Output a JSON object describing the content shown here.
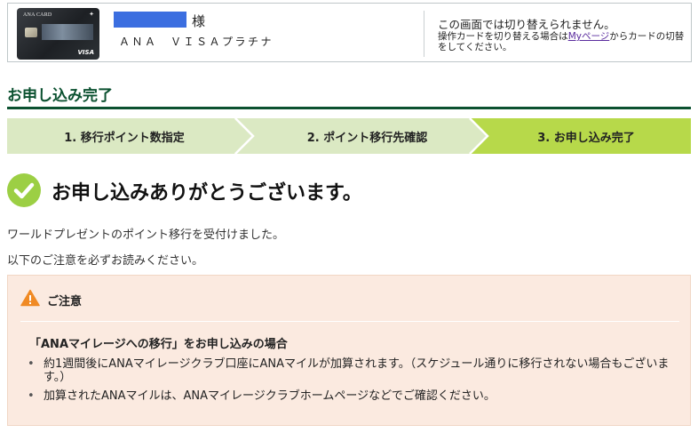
{
  "card": {
    "brand_text": "ANA CARD",
    "network_text": "VISA",
    "name_suffix": "様",
    "card_name": "ＡＮＡ　ＶＩＳＡプラチナ"
  },
  "notice": {
    "main": "この画面では切り替えられません。",
    "sub_before": "操作カードを切り替える場合は",
    "sub_link": "Myページ",
    "sub_after": "からカードの切替をしてください。"
  },
  "page": {
    "title": "お申し込み完了"
  },
  "steps": [
    {
      "label": "1. 移行ポイント数指定"
    },
    {
      "label": "2. ポイント移行先確認"
    },
    {
      "label": "3. お申し込み完了"
    }
  ],
  "completion": {
    "heading": "お申し込みありがとうございます。",
    "message1": "ワールドプレゼントのポイント移行を受付けました。",
    "message2": "以下のご注意を必ずお読みください。"
  },
  "caution": {
    "title": "ご注意",
    "case_title": "「ANAマイレージへの移行」をお申し込みの場合",
    "bullets": [
      "約1週間後にANAマイレージクラブ口座にANAマイルが加算されます。（スケジュール通りに移行されない場合もございます。）",
      "加算されたANAマイルは、ANAマイレージクラブホームページなどでご確認ください。"
    ]
  },
  "colors": {
    "brand_green": "#0b5130",
    "step_inactive": "#dbe9c3",
    "step_active": "#b7d94a",
    "check_green": "#9ccf44",
    "caution_bg": "#fbeae0",
    "warning_orange": "#f08a24",
    "link_purple": "#5a2b9e"
  },
  "icons": {
    "completion": "check-circle-icon",
    "caution": "warning-triangle-icon"
  }
}
